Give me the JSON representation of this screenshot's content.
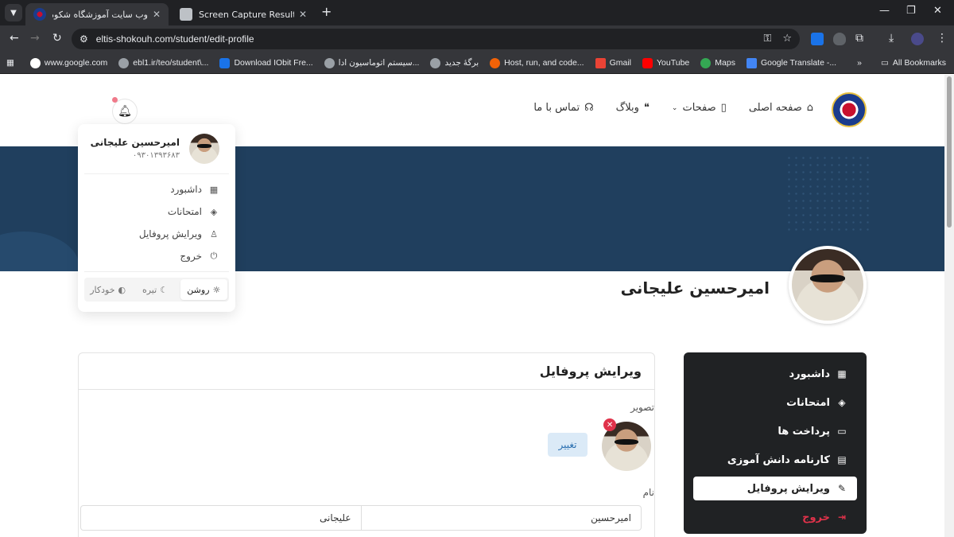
{
  "browser": {
    "tabs": [
      {
        "title": "وب سایت آموزشگاه شکوه دماوند",
        "active": true
      },
      {
        "title": "Screen Capture Result",
        "active": false
      }
    ],
    "url": "eltis-shokouh.com/student/edit-profile",
    "bookmarks": [
      "www.google.com",
      "ebl1.ir/teo/student\\...",
      "Download IObit Fre...",
      "سیستم اتوماسیون ادا...",
      "برگهٔ جدید",
      "Host, run, and code...",
      "Gmail",
      "YouTube",
      "Maps",
      "Google Translate -..."
    ],
    "all_bookmarks": "All Bookmarks"
  },
  "nav": {
    "home": "صفحه اصلی",
    "pages": "صفحات",
    "blog": "وبلاگ",
    "contact": "تماس با ما"
  },
  "profile": {
    "name": "امیرحسین علیجانی"
  },
  "dropdown": {
    "name": "امیرحسین علیجانی",
    "phone": "۰۹۳۰۱۳۹۳۶۸۳",
    "items": [
      "داشبورد",
      "امتحانات",
      "ویرایش پروفایل",
      "خروج"
    ],
    "themes": [
      "روشن",
      "تیره",
      "خودکار"
    ]
  },
  "sidebar": {
    "items": [
      "داشبورد",
      "امتحانات",
      "پرداخت ها",
      "کارنامه دانش آموزی",
      "ویرایش پروفایل",
      "خروج"
    ]
  },
  "edit": {
    "title": "ویرایش پروفایل",
    "image_label": "تصویر",
    "change_button": "تغییر",
    "name_label": "نام",
    "first_name_value": "امیرحسین",
    "last_name_value": "علیجانی"
  }
}
